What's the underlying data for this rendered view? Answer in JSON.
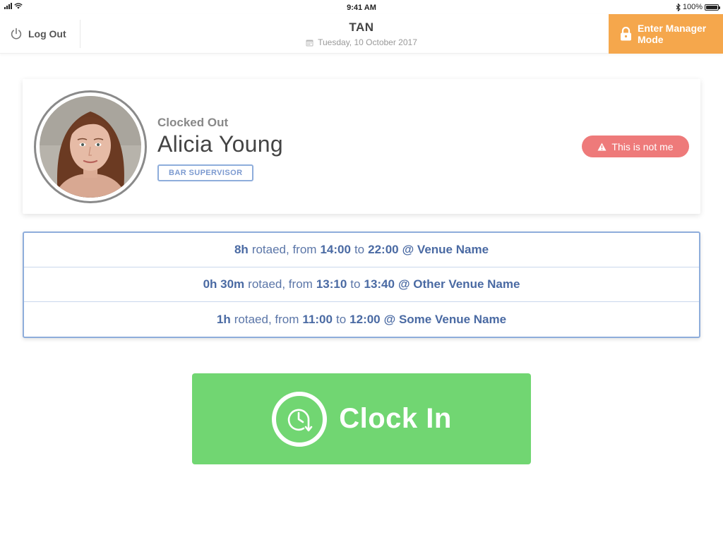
{
  "status_bar": {
    "time": "9:41 AM",
    "battery": "100%"
  },
  "header": {
    "logout_label": "Log Out",
    "venue_code": "TAN",
    "date": "Tuesday, 10 October 2017",
    "manager_label": "Enter Manager Mode"
  },
  "profile": {
    "status": "Clocked Out",
    "name": "Alicia Young",
    "role": "BAR SUPERVISOR",
    "not_me_label": "This is not me"
  },
  "shifts": [
    {
      "duration": "8h",
      "rotaed_text": "rotaed, from",
      "start": "14:00",
      "to_text": "to",
      "end": "22:00",
      "at_venue": "@ Venue Name"
    },
    {
      "duration": "0h 30m",
      "rotaed_text": "rotaed, from",
      "start": "13:10",
      "to_text": "to",
      "end": "13:40",
      "at_venue": "@ Other Venue Name"
    },
    {
      "duration": "1h",
      "rotaed_text": "rotaed, from",
      "start": "11:00",
      "to_text": "to",
      "end": "12:00",
      "at_venue": "@ Some Venue Name"
    }
  ],
  "clock_in_label": "Clock In",
  "colors": {
    "manager_accent": "#f5a74c",
    "danger": "#ee7a7a",
    "clock_in_green": "#71d672",
    "shift_blue": "#4a6aa3"
  }
}
